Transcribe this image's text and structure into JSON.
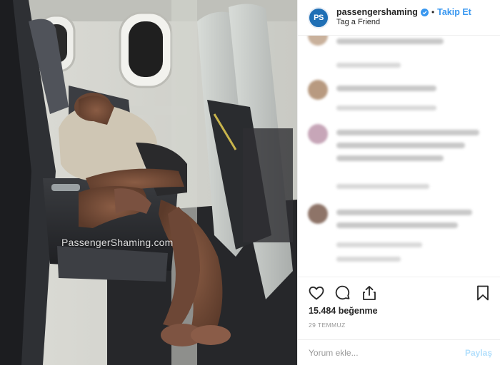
{
  "photo": {
    "watermark": "PassengerShaming.com"
  },
  "header": {
    "avatar_initials": "PS",
    "username": "passengershaming",
    "separator": "•",
    "follow_label": "Takip Et",
    "location": "Tag a Friend"
  },
  "actions": {
    "like_icon": "heart-icon",
    "comment_icon": "comment-icon",
    "share_icon": "share-icon",
    "save_icon": "bookmark-icon"
  },
  "likes_text": "15.484 beğenme",
  "date_text": "29 TEMMUZ",
  "comment_box": {
    "placeholder": "Yorum ekle...",
    "post_label": "Paylaş"
  },
  "colors": {
    "accent": "#3897f0",
    "post_disabled": "#b2dffc",
    "avatar_bg": "#1f6fb5"
  }
}
